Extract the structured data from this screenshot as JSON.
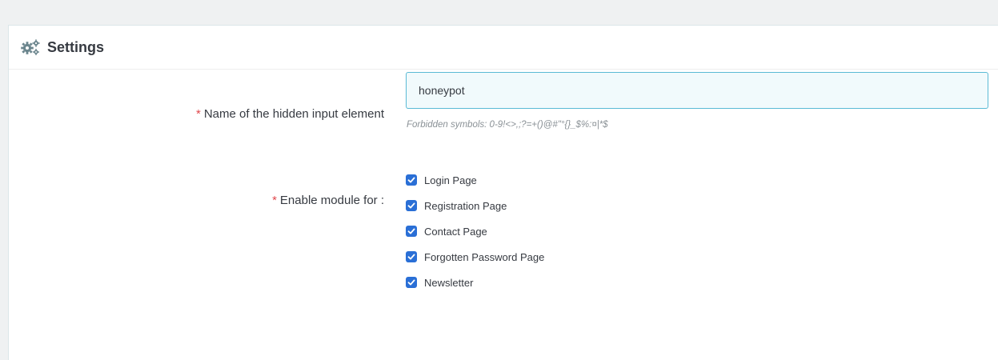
{
  "panel": {
    "title": "Settings",
    "icon": "cogs-icon"
  },
  "form": {
    "hidden_input": {
      "required_mark": "*",
      "label": "Name of the hidden input element",
      "value": "honeypot",
      "help": "Forbidden symbols: 0-9!<>,;?=+()@#\"°{}_$%:¤|*$"
    },
    "enable_module": {
      "required_mark": "*",
      "label": "Enable module for :",
      "options": [
        {
          "label": "Login Page",
          "checked": true
        },
        {
          "label": "Registration Page",
          "checked": true
        },
        {
          "label": "Contact Page",
          "checked": true
        },
        {
          "label": "Forgotten Password Page",
          "checked": true
        },
        {
          "label": "Newsletter",
          "checked": true
        }
      ]
    }
  },
  "colors": {
    "required": "#e0484d",
    "checkbox": "#2a6fd6",
    "input_border": "#5bbad5",
    "input_bg": "#f1fafc"
  }
}
